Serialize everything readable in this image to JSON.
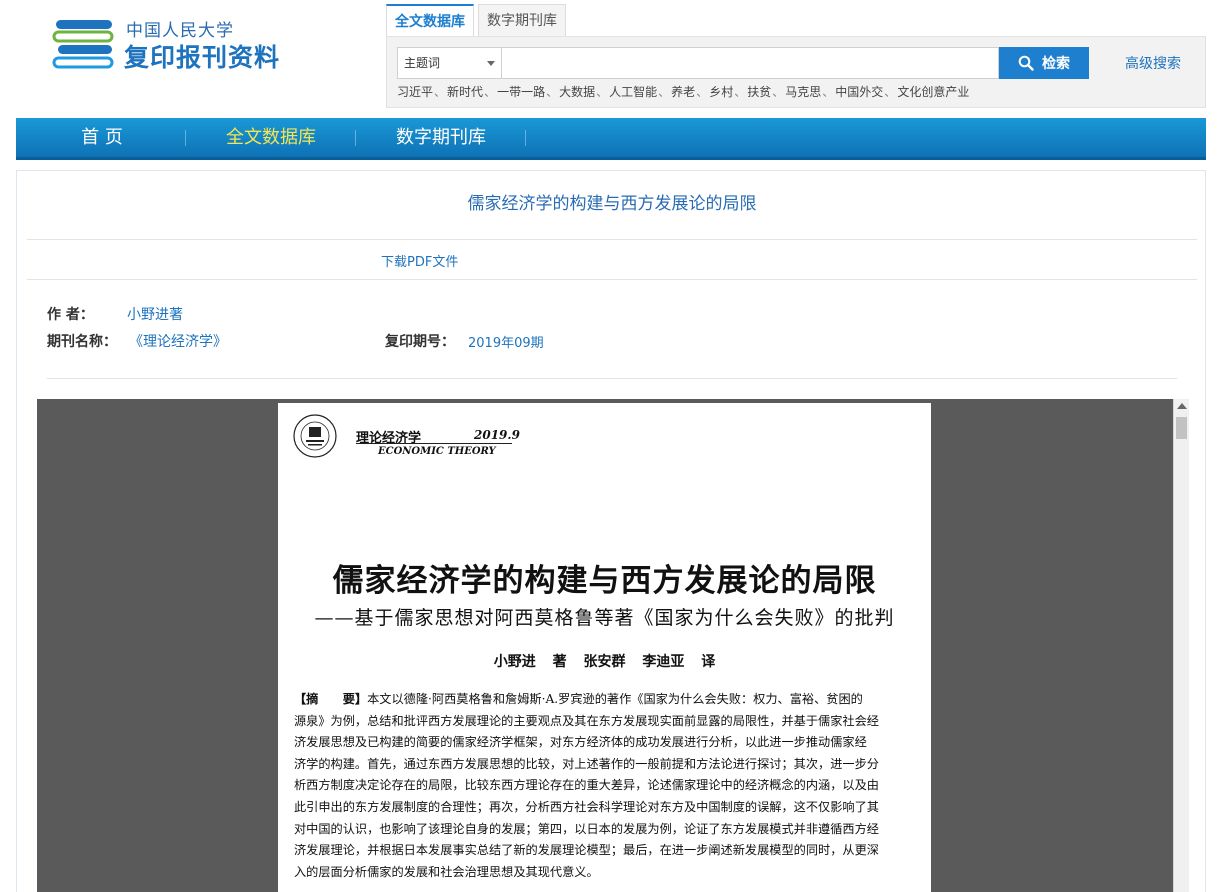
{
  "logo": {
    "line1": "中国人民大学",
    "line2": "复印报刊资料"
  },
  "search": {
    "tabs": [
      {
        "label": "全文数据库",
        "active": true
      },
      {
        "label": "数字期刊库",
        "active": false
      }
    ],
    "field_select": "主题词",
    "query": "",
    "button_label": "检索",
    "advanced_label": "高级搜索",
    "hot_words": [
      "习近平",
      "新时代",
      "一带一路",
      "大数据",
      "人工智能",
      "养老",
      "乡村",
      "扶贫",
      "马克思",
      "中国外交",
      "文化创意产业"
    ],
    "hot_separator": "、"
  },
  "nav": {
    "items": [
      {
        "label": "首 页",
        "active": false
      },
      {
        "label": "全文数据库",
        "active": true
      },
      {
        "label": "数字期刊库",
        "active": false
      }
    ]
  },
  "article": {
    "title": "儒家经济学的构建与西方发展论的局限",
    "download_label": "下载PDF文件",
    "author_label": "作  者：",
    "author_value": "小野进著",
    "journal_label": "期刊名称：",
    "journal_value": "《理论经济学》",
    "issue_label": "复印期号：",
    "issue_value": "2019年09期"
  },
  "pdf": {
    "journal": "理论经济学",
    "issue": "2019.9",
    "journal_en": "ECONOMIC THEORY",
    "title": "儒家经济学的构建与西方发展论的局限",
    "subtitle": "——基于儒家思想对阿西莫格鲁等著《国家为什么会失败》的批判",
    "authors": "小野进 著  张安群  李迪亚 译",
    "abstract_label": "【摘　　要】",
    "abstract_lines": [
      "本文以德隆·阿西莫格鲁和詹姆斯·A.罗宾逊的著作《国家为什么会失败：权力、富裕、贫困的",
      "源泉》为例，总结和批评西方发展理论的主要观点及其在东方发展现实面前显露的局限性，并基于儒家社会经",
      "济发展思想及已构建的简要的儒家经济学框架，对东方经济体的成功发展进行分析，以此进一步推动儒家经",
      "济学的构建。首先，通过东西方发展思想的比较，对上述著作的一般前提和方法论进行探讨；其次，进一步分",
      "析西方制度决定论存在的局限，比较东西方理论存在的重大差异，论述儒家理论中的经济概念的内涵，以及由",
      "此引申出的东方发展制度的合理性；再次，分析西方社会科学理论对东方及中国制度的误解，这不仅影响了其",
      "对中国的认识，也影响了该理论自身的发展；第四，以日本的发展为例，论证了东方发展模式并非遵循西方经",
      "济发展理论，并根据日本发展事实总结了新的发展理论模型；最后，在进一步阐述新发展模型的同时，从更深",
      "入的层面分析儒家的发展和社会治理思想及其现代意义。"
    ]
  },
  "colors": {
    "brand_blue": "#1e73be",
    "nav_active": "#f4e652",
    "viewer_bg": "#5a5a5a"
  }
}
